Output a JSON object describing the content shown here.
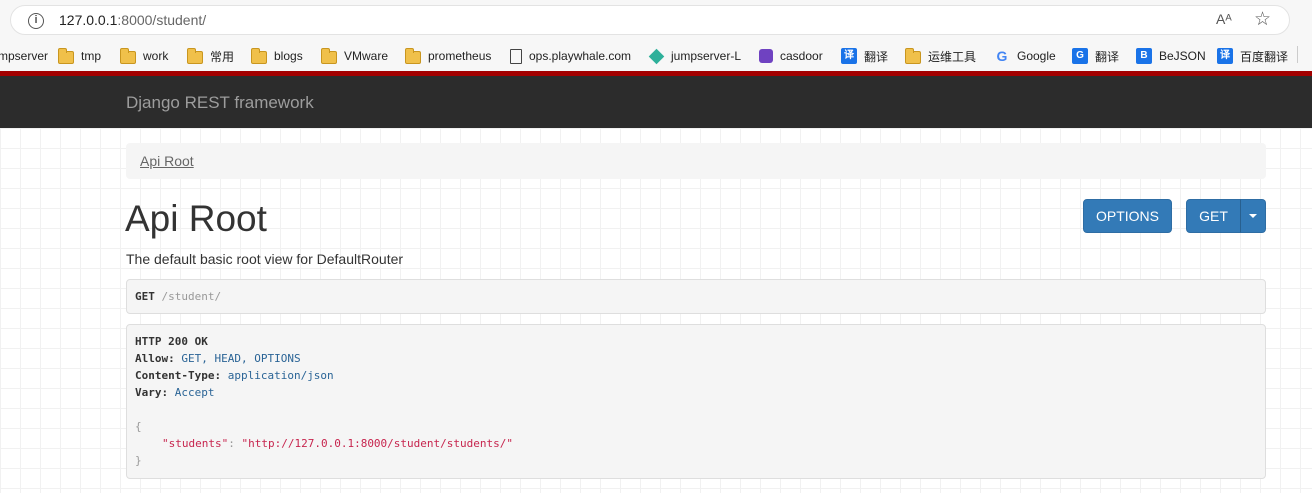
{
  "browser": {
    "url_host": "127.0.0.1",
    "url_rest": ":8000/student/",
    "read_aloud_label": "Aᴬ",
    "bookmarks": [
      {
        "label": "mpserver",
        "icon": "none"
      },
      {
        "label": "tmp",
        "icon": "folder-icon"
      },
      {
        "label": "work",
        "icon": "folder-icon"
      },
      {
        "label": "常用",
        "icon": "folder-icon"
      },
      {
        "label": "blogs",
        "icon": "folder-icon"
      },
      {
        "label": "VMware",
        "icon": "folder-icon"
      },
      {
        "label": "prometheus",
        "icon": "folder-icon"
      },
      {
        "label": "ops.playwhale.com",
        "icon": "page-icon"
      },
      {
        "label": "jumpserver-L",
        "icon": "jumpserver-icon"
      },
      {
        "label": "casdoor",
        "icon": "casdoor-icon"
      },
      {
        "label": "翻译",
        "icon": "translate-icon"
      },
      {
        "label": "运维工具",
        "icon": "folder-icon"
      },
      {
        "label": "Google",
        "icon": "google-icon"
      },
      {
        "label": "翻译",
        "icon": "google-translate-icon"
      },
      {
        "label": "BeJSON",
        "icon": "bejson-icon"
      },
      {
        "label": "百度翻译",
        "icon": "baidu-translate-icon"
      }
    ]
  },
  "navbar": {
    "brand": "Django REST framework"
  },
  "breadcrumb": {
    "item": "Api Root"
  },
  "page": {
    "title": "Api Root",
    "description": "The default basic root view for DefaultRouter",
    "options_label": "OPTIONS",
    "get_label": "GET"
  },
  "request": {
    "method": "GET",
    "path": "/student/"
  },
  "response": {
    "status": "HTTP 200 OK",
    "allow_key": "Allow:",
    "allow_value": "GET, HEAD, OPTIONS",
    "content_type_key": "Content-Type:",
    "content_type_value": "application/json",
    "vary_key": "Vary:",
    "vary_value": "Accept",
    "open_brace": "{",
    "json_key": "\"students\"",
    "json_colon": ": ",
    "json_value": "\"http://127.0.0.1:8000/student/students/\"",
    "close_brace": "}"
  },
  "colors": {
    "navbar_bg": "#2c2c2c",
    "accent_red": "#a30000",
    "button_blue": "#337ab7",
    "json_string": "#c7254e"
  }
}
